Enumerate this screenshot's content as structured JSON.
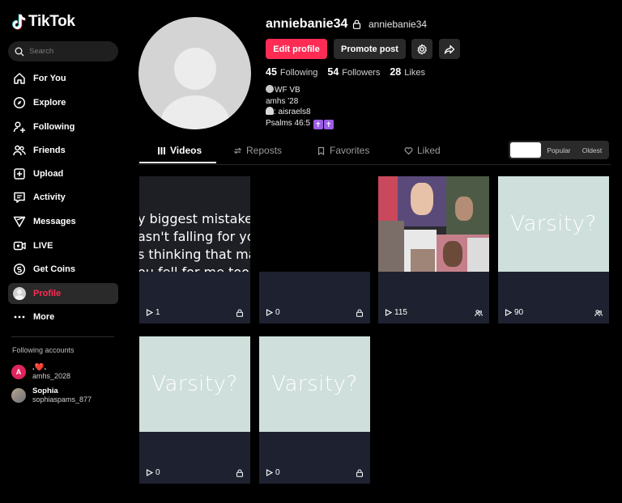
{
  "app": {
    "logo_text": "TikTok"
  },
  "search": {
    "placeholder": "Search"
  },
  "nav": [
    {
      "label": "For You",
      "icon": "home-icon"
    },
    {
      "label": "Explore",
      "icon": "compass-icon"
    },
    {
      "label": "Following",
      "icon": "person-add-icon"
    },
    {
      "label": "Friends",
      "icon": "friends-icon"
    },
    {
      "label": "Upload",
      "icon": "upload-icon"
    },
    {
      "label": "Activity",
      "icon": "chat-icon"
    },
    {
      "label": "Messages",
      "icon": "send-icon"
    },
    {
      "label": "LIVE",
      "icon": "live-icon"
    },
    {
      "label": "Get Coins",
      "icon": "coin-icon"
    },
    {
      "label": "Profile",
      "icon": "avatar"
    },
    {
      "label": "More",
      "icon": "more-icon"
    }
  ],
  "following_accounts": {
    "title": "Following accounts",
    "accounts": [
      {
        "initial": "A",
        "name": ".❤️.",
        "handle": "amhs_2028",
        "color": "#e0245e"
      },
      {
        "initial": "",
        "name": "Sophia",
        "handle": "sophiaspams_877",
        "color": "#8a8a8a"
      }
    ]
  },
  "profile": {
    "username": "anniebanie34",
    "handle": "anniebanie34",
    "edit_label": "Edit profile",
    "promote_label": "Promote post",
    "stats": {
      "following_count": "45",
      "following_label": "Following",
      "followers_count": "54",
      "followers_label": "Followers",
      "likes_count": "28",
      "likes_label": "Likes"
    },
    "bio": {
      "line1": "WF VB",
      "line2": "amhs '28",
      "line3": ": aisraels8",
      "line4": "Psalms 46:5",
      "cross_glyph": "✝"
    }
  },
  "tabs": [
    {
      "label": "Videos",
      "icon": "grid-icon"
    },
    {
      "label": "Reposts",
      "icon": "repost-icon"
    },
    {
      "label": "Favorites",
      "icon": "bookmark-icon"
    },
    {
      "label": "Liked",
      "icon": "heart-icon"
    }
  ],
  "sort": {
    "options": [
      "Latest",
      "Popular",
      "Oldest"
    ],
    "selected": "Latest"
  },
  "videos": [
    {
      "views": "1",
      "badge": "lock-icon",
      "caption": [
        "y biggest mistake",
        "asn't falling for yo",
        "s thinking that ma",
        "ou fell for me too"
      ]
    },
    {
      "views": "0",
      "badge": "lock-icon"
    },
    {
      "views": "115",
      "badge": "friends-icon"
    },
    {
      "views": "90",
      "badge": "friends-icon",
      "caption_text": "Varsity?"
    },
    {
      "views": "0",
      "badge": "lock-icon",
      "caption_text": "Varsity?"
    },
    {
      "views": "0",
      "badge": "lock-icon",
      "caption_text": "Varsity?"
    }
  ],
  "colors": {
    "accent": "#fe2c55",
    "background": "#000000",
    "card": "#1e2230"
  }
}
